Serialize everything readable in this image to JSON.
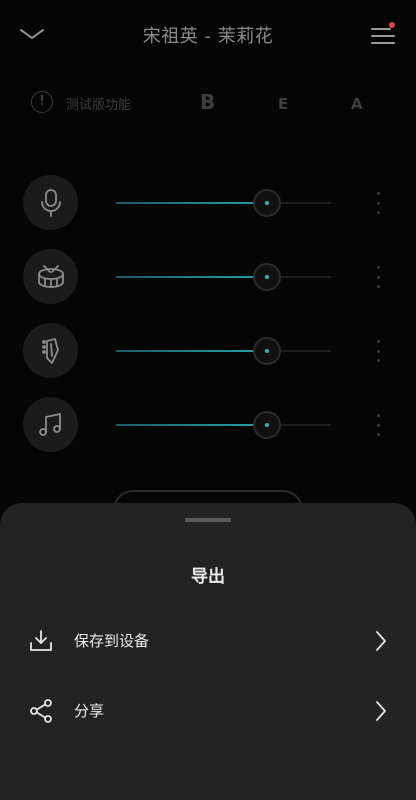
{
  "header": {
    "title": "宋祖英 - 茉莉花",
    "collapse_icon": "chevron-down-icon",
    "menu_icon": "menu-icon",
    "notification_color": "#e0463a"
  },
  "modes": {
    "info_glyph": "!",
    "beta_label": "测试版功能",
    "options": [
      "B",
      "E",
      "A"
    ]
  },
  "tracks": [
    {
      "icon": "microphone-icon",
      "level": 0.7
    },
    {
      "icon": "drum-icon",
      "level": 0.7
    },
    {
      "icon": "guitar-icon",
      "level": 0.7
    },
    {
      "icon": "music-note-icon",
      "level": 0.7
    }
  ],
  "sheet": {
    "title": "导出",
    "items": [
      {
        "label": "保存到设备",
        "icon": "download-icon"
      },
      {
        "label": "分享",
        "icon": "share-icon"
      }
    ]
  },
  "colors": {
    "accent": "#22a3a6",
    "sheet_bg": "#232323"
  }
}
